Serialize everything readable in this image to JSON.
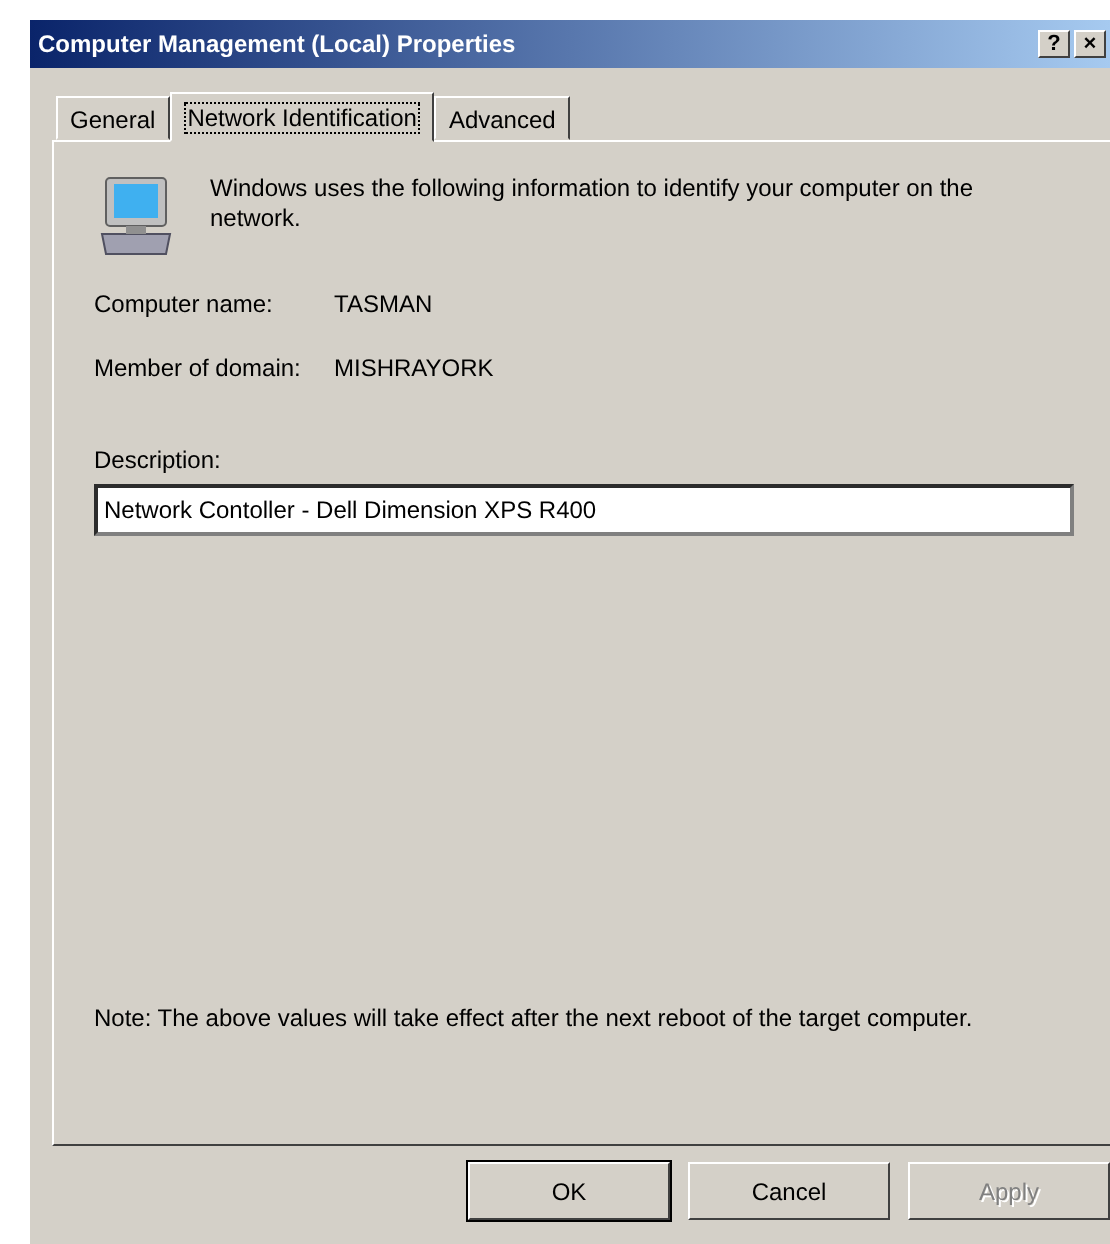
{
  "window": {
    "title": "Computer Management (Local) Properties",
    "help_button": "?",
    "close_button": "×"
  },
  "tabs": [
    {
      "label": "General",
      "selected": false
    },
    {
      "label": "Network Identification",
      "selected": true
    },
    {
      "label": "Advanced",
      "selected": false
    }
  ],
  "intro": "Windows uses the following information to identify your computer on the network.",
  "fields": [
    {
      "label": "Computer name:",
      "value": "TASMAN"
    },
    {
      "label": "Member of domain:",
      "value": "MISHRAYORK"
    }
  ],
  "description": {
    "label": "Description:",
    "value": "Network Contoller - Dell Dimension XPS R400"
  },
  "note": "Note: The above values will take effect after the next reboot of the target computer.",
  "buttons": [
    {
      "label": "OK",
      "disabled": false,
      "default": true
    },
    {
      "label": "Cancel",
      "disabled": false,
      "default": false
    },
    {
      "label": "Apply",
      "disabled": true,
      "default": false
    }
  ]
}
